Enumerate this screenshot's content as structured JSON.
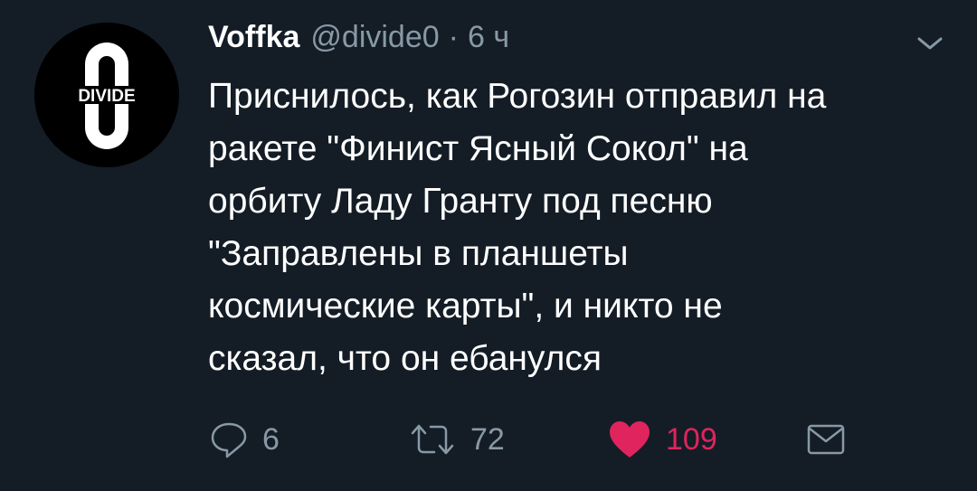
{
  "tweet": {
    "author": {
      "name": "Voffka",
      "handle": "@divide0",
      "avatar_text": "DIVIDE"
    },
    "separator": "·",
    "time": "6 ч",
    "menu_icon": "chevron-down-icon",
    "text_lines": [
      "Приснилось, как Рогозин отправил на",
      "ракете \"Финист Ясный Сокол\" на",
      "орбиту Ладу Гранту под песню",
      "\"Заправлены в планшеты",
      "космические карты\", и никто не",
      "сказал, что он ебанулся"
    ],
    "actions": {
      "reply": {
        "icon": "reply-icon",
        "count": "6"
      },
      "retweet": {
        "icon": "retweet-icon",
        "count": "72"
      },
      "like": {
        "icon": "heart-icon",
        "count": "109",
        "color": "#e0245e"
      },
      "message": {
        "icon": "envelope-icon"
      }
    }
  },
  "colors": {
    "background": "#141d26",
    "text": "#ffffff",
    "muted": "#8899a6",
    "like": "#e0245e"
  }
}
